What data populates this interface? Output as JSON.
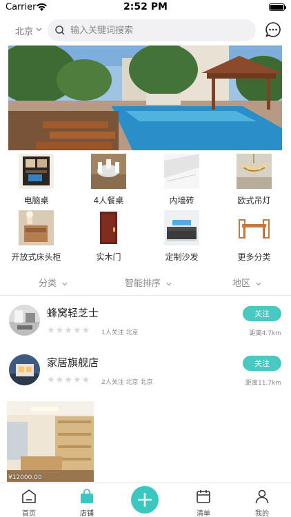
{
  "status_bar": {
    "carrier": "Carrier",
    "time": "2:52 PM"
  },
  "header": {
    "city": "北京",
    "search_placeholder": "输入关键词搜索",
    "message_icon": "chat-bubble-icon"
  },
  "categories": [
    {
      "label": "电脑桌"
    },
    {
      "label": "4人餐桌"
    },
    {
      "label": "内墙砖"
    },
    {
      "label": "欧式吊灯"
    },
    {
      "label": "开放式床头柜"
    },
    {
      "label": "实木门"
    },
    {
      "label": "定制沙发"
    },
    {
      "label": "更多分类"
    }
  ],
  "filters": [
    {
      "label": "分类"
    },
    {
      "label": "智能排序"
    },
    {
      "label": "地区"
    }
  ],
  "shops": [
    {
      "name": "蜂窝轻芝士",
      "meta": "1人关注  北京",
      "follow_label": "关注",
      "distance": "距离4.7km",
      "rating": 0
    },
    {
      "name": "家居旗舰店",
      "meta": "2人关注  北京 北京",
      "follow_label": "关注",
      "distance": "距离11.7km",
      "rating": 0
    }
  ],
  "product": {
    "price": "¥12000.00"
  },
  "tabbar": [
    {
      "label": "首页",
      "icon": "home-icon"
    },
    {
      "label": "店铺",
      "icon": "shopping-bag-icon",
      "active": true
    },
    {
      "label": "",
      "icon": "plus-icon"
    },
    {
      "label": "清单",
      "icon": "calendar-icon"
    },
    {
      "label": "我的",
      "icon": "user-icon"
    }
  ],
  "colors": {
    "accent": "#4ac8c2",
    "active_tab": "#3cc6c0"
  }
}
